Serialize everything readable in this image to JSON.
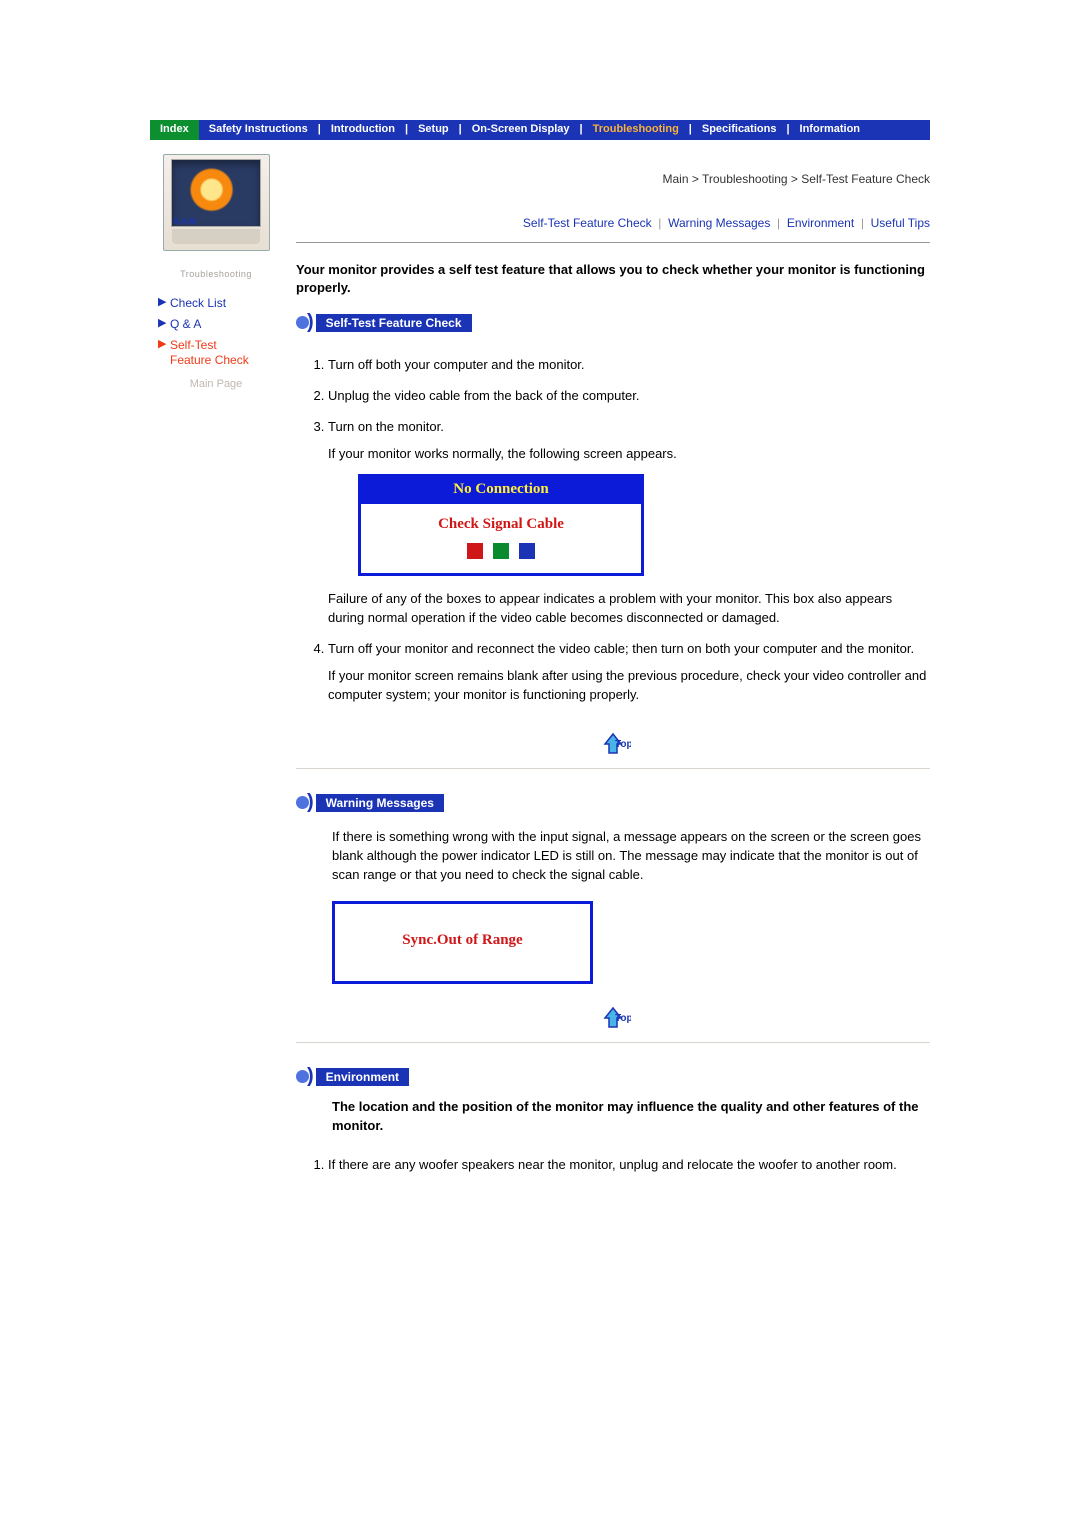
{
  "nav": {
    "index": "Index",
    "safety": "Safety Instructions",
    "intro": "Introduction",
    "setup": "Setup",
    "osd": "On-Screen Display",
    "trouble": "Troubleshooting",
    "specs": "Specifications",
    "info": "Information"
  },
  "sidebar": {
    "brand": "S A-M",
    "category": "Troubleshooting",
    "items": {
      "checklist": "Check List",
      "qa": "Q & A",
      "selftest_l1": "Self-Test",
      "selftest_l2": "Feature Check"
    },
    "mainpage": "Main Page"
  },
  "breadcrumb": "Main > Troubleshooting > Self-Test Feature Check",
  "sublinks": {
    "selftest": "Self-Test Feature Check",
    "warning": "Warning Messages",
    "env": "Environment",
    "tips": "Useful Tips"
  },
  "intro": "Your monitor provides a self test feature that allows you to check whether your monitor is functioning properly.",
  "sections": {
    "selftest": "Self-Test Feature Check",
    "warning": "Warning Messages",
    "environment": "Environment"
  },
  "steps1": {
    "s1": "Turn off both your computer and the monitor.",
    "s2": "Unplug the video cable from the back of the computer.",
    "s3": "Turn on the monitor.",
    "s3_sub": "If your monitor works normally, the following screen appears.",
    "s3_after": "Failure of any of the boxes to appear indicates a problem with your monitor. This box also appears during normal operation if the video cable becomes disconnected or damaged.",
    "s4": "Turn off your monitor and reconnect the video cable; then turn on both your computer and the monitor.",
    "s4_sub": "If your monitor screen remains blank after using the previous procedure, check your video controller and computer system; your monitor is functioning properly."
  },
  "noconn": {
    "title": "No Connection",
    "msg": "Check Signal Cable"
  },
  "warning_para": "If there is something wrong with the input signal, a message appears on the screen or the screen goes blank although the power indicator LED is still on. The message may indicate that the monitor is out of scan range or that you need to check the signal cable.",
  "sync_msg": "Sync.Out of Range",
  "env_intro": "The location and the position of the monitor may influence the quality and other features of the monitor.",
  "env_steps": {
    "s1": "If there are any woofer speakers near the monitor, unplug and relocate the woofer to another room."
  },
  "top_label": "Top",
  "sep": "|"
}
